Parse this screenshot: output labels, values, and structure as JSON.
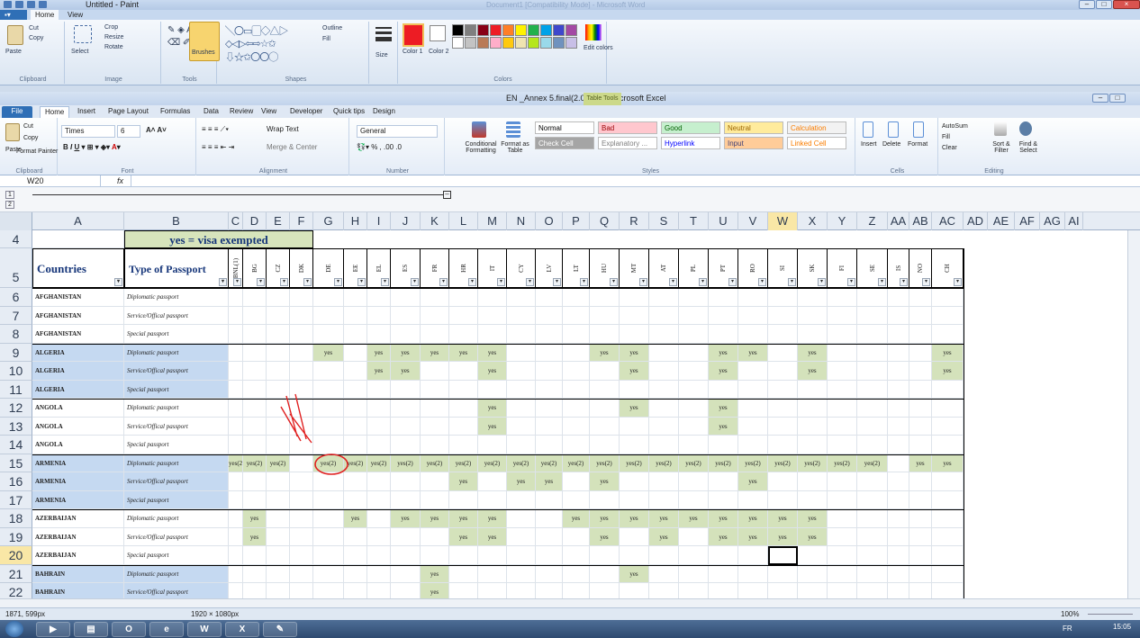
{
  "paint": {
    "title": "Untitled - Paint",
    "ghost_title": "Document1 [Compatibility Mode] - Microsoft Word",
    "tabs": [
      "Home",
      "View"
    ],
    "groups": {
      "clipboard": "Clipboard",
      "image": "Image",
      "tools": "Tools",
      "shapes": "Shapes",
      "colors": "Colors"
    },
    "buttons": {
      "paste": "Paste",
      "cut": "Cut",
      "copy": "Copy",
      "select": "Select",
      "crop": "Crop",
      "resize": "Resize",
      "rotate": "Rotate",
      "brushes": "Brushes",
      "outline": "Outline",
      "fill": "Fill",
      "size": "Size",
      "color1": "Color 1",
      "color2": "Color 2",
      "edit_colors": "Edit colors"
    },
    "palette": [
      "#000000",
      "#7f7f7f",
      "#880015",
      "#ed1c24",
      "#ff7f27",
      "#fff200",
      "#22b14c",
      "#00a2e8",
      "#3f48cc",
      "#a349a4",
      "#ffffff",
      "#c3c3c3",
      "#b97a57",
      "#ffaec9",
      "#ffc90e",
      "#efe4b0",
      "#b5e61d",
      "#99d9ea",
      "#7092be",
      "#c8bfe7"
    ]
  },
  "excel": {
    "title": "EN _Annex 5.final(2.0).xlsx - Microsoft Excel",
    "table_tools": "Table Tools",
    "tabs": [
      "File",
      "Home",
      "Insert",
      "Page Layout",
      "Formulas",
      "Data",
      "Review",
      "View",
      "Developer",
      "Quick tips",
      "Design"
    ],
    "clipboard": {
      "paste": "Paste",
      "cut": "Cut",
      "copy": "Copy",
      "format_painter": "Format Painter",
      "label": "Clipboard"
    },
    "font": {
      "name": "Times",
      "size": "6",
      "label": "Font"
    },
    "alignment": {
      "wrap": "Wrap Text",
      "merge": "Merge & Center",
      "label": "Alignment"
    },
    "number": {
      "format": "General",
      "label": "Number"
    },
    "styles": {
      "cond": "Conditional Formatting",
      "fmt_table": "Format as Table",
      "label": "Styles",
      "items": [
        {
          "t": "Normal",
          "bg": "#ffffff",
          "c": "#000000"
        },
        {
          "t": "Bad",
          "bg": "#ffc7ce",
          "c": "#9c0006"
        },
        {
          "t": "Good",
          "bg": "#c6efce",
          "c": "#006100"
        },
        {
          "t": "Neutral",
          "bg": "#ffeb9c",
          "c": "#9c6500"
        },
        {
          "t": "Calculation",
          "bg": "#f2f2f2",
          "c": "#fa7d00"
        },
        {
          "t": "Check Cell",
          "bg": "#a5a5a5",
          "c": "#ffffff"
        },
        {
          "t": "Explanatory ...",
          "bg": "#ffffff",
          "c": "#7f7f7f"
        },
        {
          "t": "Hyperlink",
          "bg": "#ffffff",
          "c": "#0000ff"
        },
        {
          "t": "Input",
          "bg": "#ffcc99",
          "c": "#3f3f76"
        },
        {
          "t": "Linked Cell",
          "bg": "#ffffff",
          "c": "#fa7d00"
        }
      ]
    },
    "cells": {
      "insert": "Insert",
      "delete": "Delete",
      "format": "Format",
      "label": "Cells"
    },
    "editing": {
      "autosum": "AutoSum",
      "fill": "Fill",
      "clear": "Clear",
      "sort": "Sort & Filter",
      "find": "Find & Select",
      "label": "Editing"
    },
    "namebox": "W20",
    "fx": "fx",
    "outline_levels": [
      "1",
      "2"
    ],
    "columns": [
      "A",
      "B",
      "C",
      "D",
      "E",
      "F",
      "G",
      "H",
      "I",
      "J",
      "K",
      "L",
      "M",
      "N",
      "O",
      "P",
      "Q",
      "R",
      "S",
      "T",
      "U",
      "V",
      "W",
      "X",
      "Y",
      "Z",
      "AA",
      "AB",
      "AC",
      "AD",
      "AE",
      "AF",
      "AG",
      "AI"
    ],
    "row4": {
      "num": "4",
      "legend": "yes = visa exempted"
    },
    "row5": {
      "num": "5",
      "countries": "Countries",
      "type": "Type of Passport",
      "codes": [
        "BNL(1)",
        "BG",
        "CZ",
        "DK",
        "DE",
        "EE",
        "EL",
        "ES",
        "FR",
        "HR",
        "IT",
        "CY",
        "LV",
        "LT",
        "HU",
        "MT",
        "AT",
        "PL",
        "PT",
        "RO",
        "SI",
        "SK",
        "FI",
        "SE",
        "IS",
        "NO",
        "CH"
      ]
    },
    "rows": [
      {
        "n": "6",
        "country": "AFGHANISTAN",
        "type": "Diplomatic passport",
        "blue": false,
        "vals": {}
      },
      {
        "n": "7",
        "country": "AFGHANISTAN",
        "type": "Service/Offical passport",
        "blue": false,
        "vals": {}
      },
      {
        "n": "8",
        "country": "AFGHANISTAN",
        "type": "Special passport",
        "blue": false,
        "vals": {}
      },
      {
        "n": "9",
        "country": "ALGERIA",
        "type": "Diplomatic passport",
        "blue": true,
        "vals": {
          "4": "yes",
          "6": "yes",
          "7": "yes",
          "8": "yes",
          "9": "yes",
          "10": "yes",
          "14": "yes",
          "15": "yes",
          "18": "yes",
          "19": "yes",
          "21": "yes",
          "26": "yes"
        }
      },
      {
        "n": "10",
        "country": "ALGERIA",
        "type": "Service/Offical passport",
        "blue": true,
        "vals": {
          "6": "yes",
          "7": "yes",
          "10": "yes",
          "15": "yes",
          "18": "yes",
          "21": "yes",
          "26": "yes"
        }
      },
      {
        "n": "11",
        "country": "ALGERIA",
        "type": "Special passport",
        "blue": true,
        "vals": {}
      },
      {
        "n": "12",
        "country": "ANGOLA",
        "type": "Diplomatic passport",
        "blue": false,
        "vals": {
          "10": "yes",
          "15": "yes",
          "18": "yes"
        }
      },
      {
        "n": "13",
        "country": "ANGOLA",
        "type": "Service/Offical passport",
        "blue": false,
        "vals": {
          "10": "yes",
          "18": "yes"
        }
      },
      {
        "n": "14",
        "country": "ANGOLA",
        "type": "Special passport",
        "blue": false,
        "vals": {}
      },
      {
        "n": "15",
        "country": "ARMENIA",
        "type": "Diplomatic passport",
        "blue": true,
        "vals": {
          "0": "yes(2)",
          "1": "yes(2)",
          "2": "yes(2)",
          "4": "yes(2)",
          "5": "yes(2)",
          "6": "yes(2)",
          "7": "yes(2)",
          "8": "yes(2)",
          "9": "yes(2)",
          "10": "yes(2)",
          "11": "yes(2)",
          "12": "yes(2)",
          "13": "yes(2)",
          "14": "yes(2)",
          "15": "yes(2)",
          "16": "yes(2)",
          "17": "yes(2)",
          "18": "yes(2)",
          "19": "yes(2)",
          "20": "yes(2)",
          "21": "yes(2)",
          "22": "yes(2)",
          "23": "yes(2)",
          "25": "yes",
          "26": "yes"
        }
      },
      {
        "n": "16",
        "country": "ARMENIA",
        "type": "Service/Offical passport",
        "blue": true,
        "vals": {
          "9": "yes",
          "11": "yes",
          "12": "yes",
          "14": "yes",
          "19": "yes"
        }
      },
      {
        "n": "17",
        "country": "ARMENIA",
        "type": "Special passport",
        "blue": true,
        "vals": {}
      },
      {
        "n": "18",
        "country": "AZERBAIJAN",
        "type": "Diplomatic passport",
        "blue": false,
        "vals": {
          "1": "yes",
          "5": "yes",
          "7": "yes",
          "8": "yes",
          "9": "yes",
          "10": "yes",
          "13": "yes",
          "14": "yes",
          "15": "yes",
          "16": "yes",
          "17": "yes",
          "18": "yes",
          "19": "yes",
          "20": "yes",
          "21": "yes"
        }
      },
      {
        "n": "19",
        "country": "AZERBAIJAN",
        "type": "Service/Offical passport",
        "blue": false,
        "vals": {
          "1": "yes",
          "9": "yes",
          "10": "yes",
          "14": "yes",
          "16": "yes",
          "18": "yes",
          "19": "yes",
          "20": "yes",
          "21": "yes"
        }
      },
      {
        "n": "20",
        "country": "AZERBAIJAN",
        "type": "Special passport",
        "blue": false,
        "vals": {}
      },
      {
        "n": "21",
        "country": "BAHRAIN",
        "type": "Diplomatic passport",
        "blue": true,
        "vals": {
          "8": "yes",
          "15": "yes"
        }
      },
      {
        "n": "22",
        "country": "BAHRAIN",
        "type": "Service/Offical passport",
        "blue": true,
        "vals": {
          "8": "yes"
        }
      }
    ]
  },
  "status": {
    "coords": "1871, 599px",
    "dims": "1920 × 1080px",
    "zoom": "100%"
  },
  "taskbar": {
    "time": "15:05",
    "lang": "FR"
  }
}
